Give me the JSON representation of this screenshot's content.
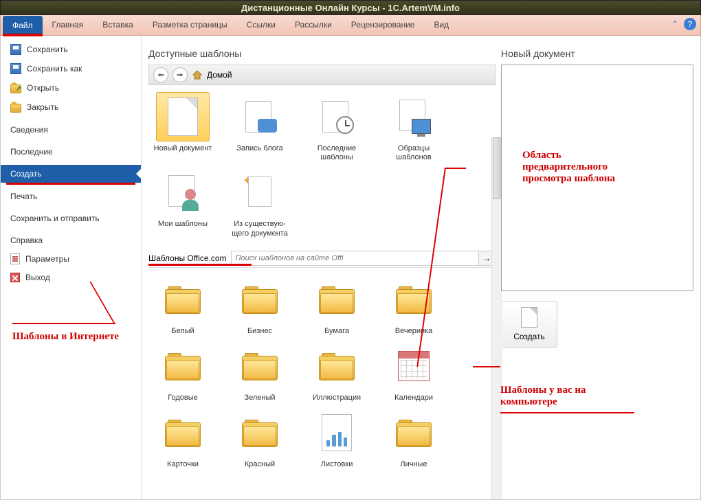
{
  "window": {
    "title": "Дистанционные Онлайн Курсы - 1C.ArtemVM.info"
  },
  "ribbon": {
    "tabs": [
      "Файл",
      "Главная",
      "Вставка",
      "Разметка страницы",
      "Ссылки",
      "Рассылки",
      "Рецензирование",
      "Вид"
    ]
  },
  "backstage": {
    "save": "Сохранить",
    "save_as": "Сохранить как",
    "open": "Открыть",
    "close": "Закрыть",
    "info": "Сведения",
    "recent": "Последние",
    "create": "Создать",
    "print": "Печать",
    "save_send": "Сохранить и отправить",
    "help": "Справка",
    "options": "Параметры",
    "exit": "Выход"
  },
  "templates": {
    "heading": "Доступные шаблоны",
    "home": "Домой",
    "items_top": [
      {
        "label": "Новый документ"
      },
      {
        "label": "Запись блога"
      },
      {
        "label": "Последние шаблоны"
      },
      {
        "label": "Образцы шаблонов"
      },
      {
        "label": "Мои шаблоны"
      },
      {
        "label": "Из существую-\nщего документа"
      }
    ],
    "office_section": "Шаблоны Office.com",
    "search_placeholder": "Поиск шаблонов на сайте Offi",
    "folders": [
      "Белый",
      "Бизнес",
      "Бумага",
      "Вечеринка",
      "Годовые",
      "Зеленый",
      "Иллюстрация",
      "Календари",
      "Карточки",
      "Красный",
      "Листовки",
      "Личные"
    ]
  },
  "preview": {
    "heading": "Новый документ",
    "create_label": "Создать"
  },
  "annotations": {
    "preview_area": "Область предварительного просмотра шаблона",
    "internet_templates": "Шаблоны в Интернете",
    "local_templates": "Шаблоны у вас на компьютере"
  }
}
